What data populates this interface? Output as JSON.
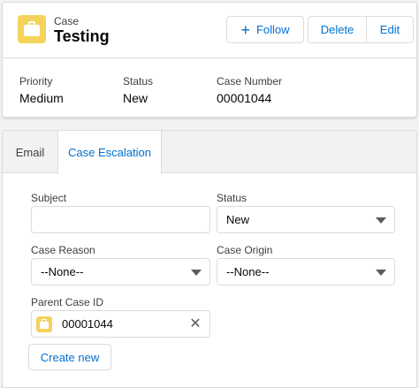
{
  "header": {
    "object_label": "Case",
    "record_title": "Testing",
    "icon": "case-icon",
    "buttons": {
      "follow": "Follow",
      "follow_icon": "plus-icon",
      "delete": "Delete",
      "edit": "Edit"
    },
    "highlights": [
      {
        "label": "Priority",
        "value": "Medium"
      },
      {
        "label": "Status",
        "value": "New"
      },
      {
        "label": "Case Number",
        "value": "00001044"
      }
    ]
  },
  "tabs": [
    {
      "label": "Email",
      "active": false
    },
    {
      "label": "Case Escalation",
      "active": true
    }
  ],
  "form": {
    "subject": {
      "label": "Subject",
      "value": ""
    },
    "status": {
      "label": "Status",
      "value": "New"
    },
    "case_reason": {
      "label": "Case Reason",
      "value": "--None--"
    },
    "case_origin": {
      "label": "Case Origin",
      "value": "--None--"
    },
    "parent_case": {
      "label": "Parent Case ID",
      "value": "00001044",
      "icon": "case-icon",
      "clear_icon": "close-icon"
    },
    "create_button": "Create new"
  },
  "colors": {
    "brand_blue": "#0070d2",
    "case_yellow": "#f5d35a",
    "background": "#f3f2f2"
  }
}
